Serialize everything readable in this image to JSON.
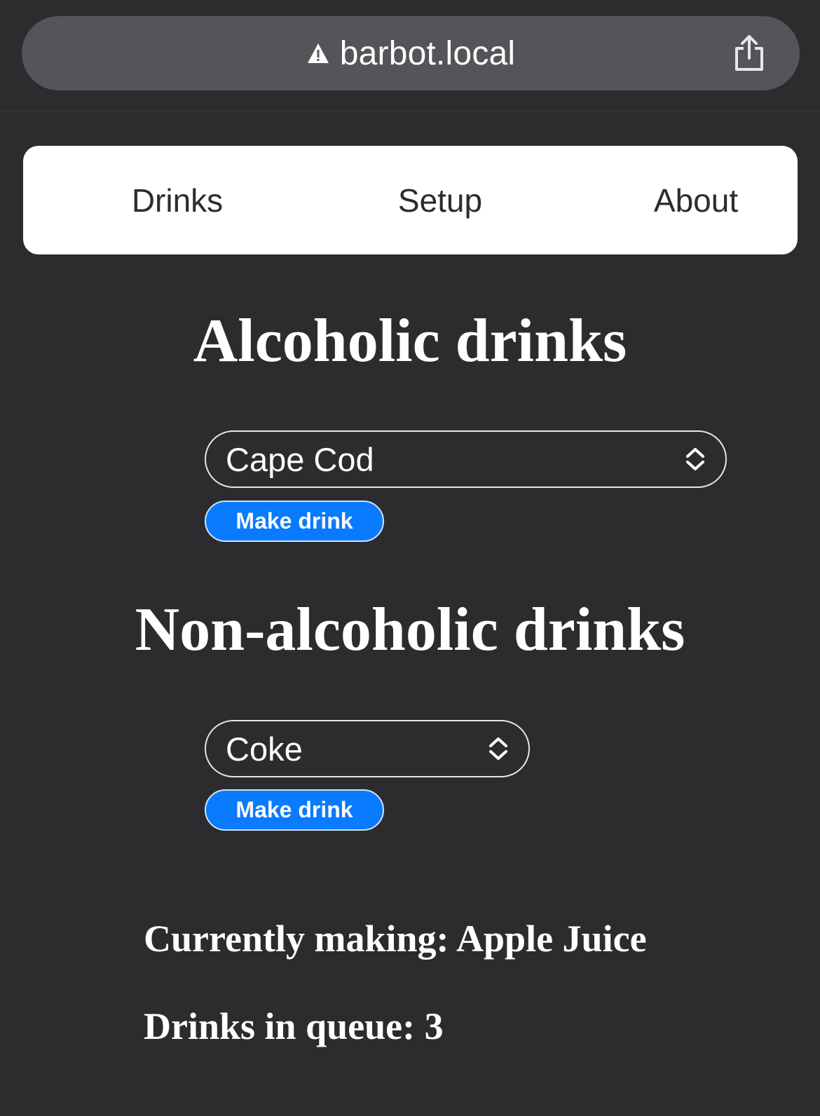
{
  "browser": {
    "url": "barbot.local",
    "warning_icon": "warning-triangle-icon",
    "share_icon": "share-icon"
  },
  "nav": {
    "items": [
      {
        "label": "Drinks"
      },
      {
        "label": "Setup"
      },
      {
        "label": "About"
      }
    ]
  },
  "alcoholic": {
    "heading": "Alcoholic drinks",
    "selected": "Cape Cod",
    "button_label": "Make drink"
  },
  "non_alcoholic": {
    "heading": "Non-alcoholic drinks",
    "selected": "Coke",
    "button_label": "Make drink"
  },
  "status": {
    "currently_making": "Currently making: Apple Juice",
    "queue": "Drinks in queue: 3"
  },
  "colors": {
    "background": "#2c2c2e",
    "url_bar": "#545559",
    "nav_background": "#ffffff",
    "accent": "#0a7aff"
  }
}
